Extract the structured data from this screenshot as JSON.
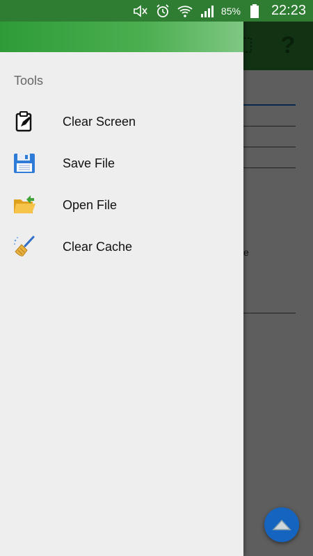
{
  "status_bar": {
    "icons": [
      "mute-icon",
      "alarm-icon",
      "wifi-icon",
      "signal-icon"
    ],
    "battery_percent": "85%",
    "time": "22:23"
  },
  "toolbar": {
    "icons": [
      "grid-icon",
      "help-icon"
    ],
    "help_glyph": "?"
  },
  "background": {
    "fragment_text": "e"
  },
  "drawer": {
    "section_title": "Tools",
    "items": [
      {
        "label": "Clear Screen",
        "icon": "clipboard-edit-icon"
      },
      {
        "label": "Save File",
        "icon": "floppy-disk-icon"
      },
      {
        "label": "Open File",
        "icon": "open-folder-icon"
      },
      {
        "label": "Clear Cache",
        "icon": "broom-icon"
      }
    ]
  },
  "colors": {
    "status_bar": "#2e7d32",
    "header_gradient_start": "#2e9b38",
    "header_gradient_end": "#7fc784",
    "fab": "#1565c0"
  }
}
